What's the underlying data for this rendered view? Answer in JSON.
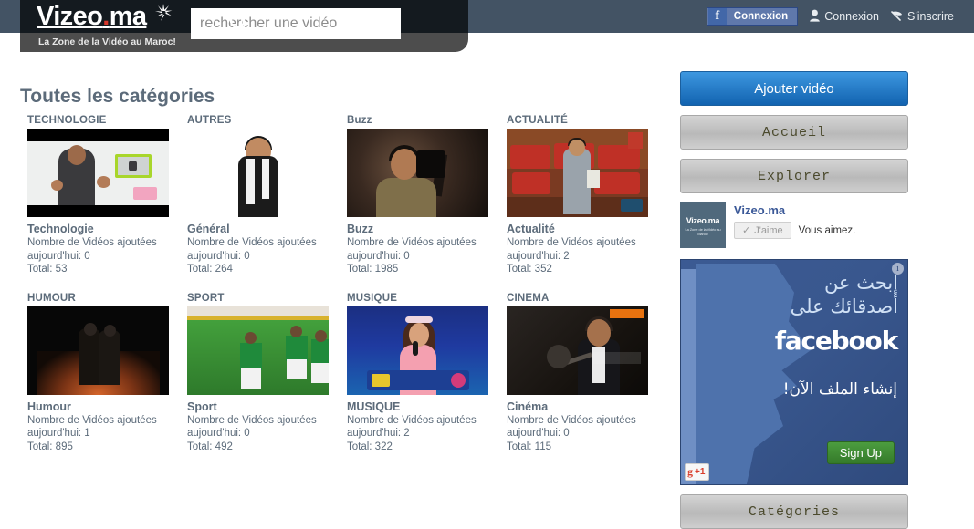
{
  "header": {
    "logo_text": "Vizeo",
    "logo_dot": ".",
    "logo_suffix": "ma",
    "tagline": "La Zone de la Vidéo au Maroc!",
    "search_placeholder": "rechercher une vidéo",
    "search_value": "",
    "search_icon": "search-icon",
    "fb_login_label": "Connexion",
    "fb_glyph": "f",
    "login_label": "Connexion",
    "login_icon": "user-icon",
    "signup_label": "S'inscrire",
    "signup_icon": "quill-icon"
  },
  "main": {
    "page_title": "Toutes les catégories",
    "meta_line1": "Nombre de Vidéos ajoutées",
    "categories": [
      {
        "heading": "TECHNOLOGIE",
        "name": "Technologie",
        "today_label": "aujourd'hui: 0",
        "total_label": "Total: 53",
        "art": "th-tech"
      },
      {
        "heading": "AUTRES",
        "name": "Général",
        "today_label": "aujourd'hui: 0",
        "total_label": "Total: 264",
        "art": "th-autres"
      },
      {
        "heading": "Buzz",
        "name": "Buzz",
        "today_label": "aujourd'hui: 0",
        "total_label": "Total: 1985",
        "art": "th-buzz"
      },
      {
        "heading": "ACTUALITÉ",
        "name": "Actualité",
        "today_label": "aujourd'hui: 2",
        "total_label": "Total: 352",
        "art": "th-actu"
      },
      {
        "heading": "HUMOUR",
        "name": "Humour",
        "today_label": "aujourd'hui: 1",
        "total_label": "Total: 895",
        "art": "th-humour"
      },
      {
        "heading": "SPORT",
        "name": "Sport",
        "today_label": "aujourd'hui: 0",
        "total_label": "Total: 492",
        "art": "th-sport"
      },
      {
        "heading": "MUSIQUE",
        "name": "MUSIQUE",
        "today_label": "aujourd'hui: 2",
        "total_label": "Total: 322",
        "art": "th-mus"
      },
      {
        "heading": "CINEMA",
        "name": "Cinéma",
        "today_label": "aujourd'hui: 0",
        "total_label": "Total: 115",
        "art": "th-cine"
      }
    ]
  },
  "sidebar": {
    "add_video_label": "Ajouter vidéo",
    "home_label": "Accueil",
    "explore_label": "Explorer",
    "categories_label": "Catégories",
    "facebook_widget": {
      "page_name": "Vizeo.ma",
      "thumb_title": "Vizeo.ma",
      "thumb_subtitle": "La Zone de la Vidéo au Maroc!",
      "like_label": "J'aime",
      "like_check": "✓",
      "status_text": "Vous aimez."
    },
    "ad": {
      "arabic_line1": "إبحث عن",
      "arabic_line2": "أصدقائك على",
      "brand": "facebook",
      "arabic_cta": "إنشاء الملف الآن!",
      "signup_label": "Sign Up",
      "info_glyph": "i",
      "gplus_g": "g",
      "gplus_plus": "+1"
    }
  },
  "colors": {
    "page_band": "#435364",
    "header_black": "#141a1f",
    "header_grey": "#4d4d4d",
    "accent_red": "#d8362a",
    "text_slate": "#5c6b7a",
    "primary_blue": "#1263b0",
    "facebook_blue": "#3b5998",
    "signup_green": "#4c9d3f"
  }
}
